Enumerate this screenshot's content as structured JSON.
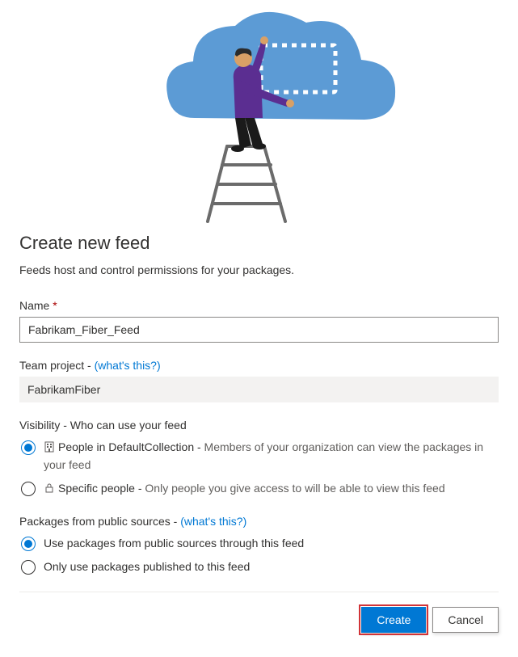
{
  "dialog": {
    "title": "Create new feed",
    "subtitle": "Feeds host and control permissions for your packages."
  },
  "name": {
    "label": "Name",
    "required_marker": "*",
    "value": "Fabrikam_Fiber_Feed"
  },
  "team_project": {
    "label": "Team project - ",
    "hint_link": "(what's this?)",
    "value": "FabrikamFiber"
  },
  "visibility": {
    "heading": "Visibility - Who can use your feed",
    "options": [
      {
        "title": "People in DefaultCollection - ",
        "desc": "Members of your organization can view the packages in your feed",
        "checked": true,
        "icon": "org"
      },
      {
        "title": "Specific people - ",
        "desc": "Only people you give access to will be able to view this feed",
        "checked": false,
        "icon": "lock"
      }
    ]
  },
  "public_sources": {
    "heading": "Packages from public sources - ",
    "hint_link": "(what's this?)",
    "options": [
      {
        "label": "Use packages from public sources through this feed",
        "checked": true
      },
      {
        "label": "Only use packages published to this feed",
        "checked": false
      }
    ]
  },
  "buttons": {
    "create": "Create",
    "cancel": "Cancel"
  }
}
